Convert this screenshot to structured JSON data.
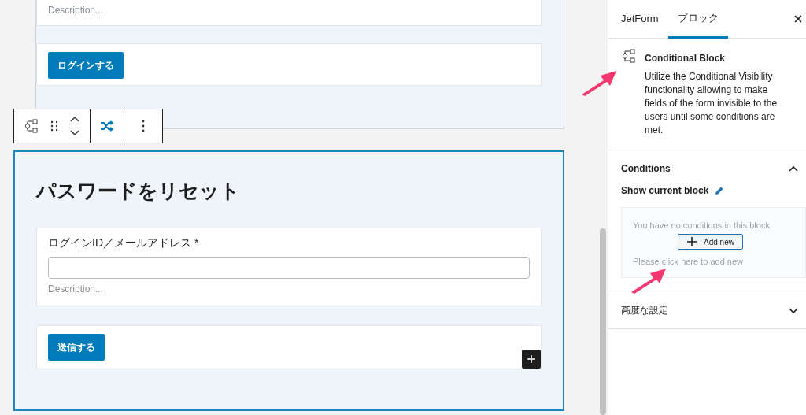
{
  "editor": {
    "top_block": {
      "description": "Description...",
      "button": "ログインする"
    },
    "toolbar": {
      "transform_active": true
    },
    "form_block": {
      "title": "パスワードをリセット",
      "field": {
        "label": "ログインID／メールアドレス *",
        "description": "Description..."
      },
      "button": "送信する",
      "selected": true
    }
  },
  "sidebar": {
    "tabs": [
      {
        "label": "JetForm",
        "selected": false
      },
      {
        "label": "ブロック",
        "selected": true
      }
    ],
    "block": {
      "name": "Conditional Block",
      "description": "Utilize the Conditional Visibility functionality allowing to make fields of the form invisible to the users until some conditions are met."
    },
    "panels": [
      {
        "title": "Conditions",
        "expanded": true
      },
      {
        "title": "高度な設定",
        "expanded": false
      }
    ],
    "conditions": {
      "heading": "Show current block",
      "empty_text": "You have no conditions in this block",
      "hint": "Please click here to add new",
      "add_button": "Add new"
    }
  }
}
